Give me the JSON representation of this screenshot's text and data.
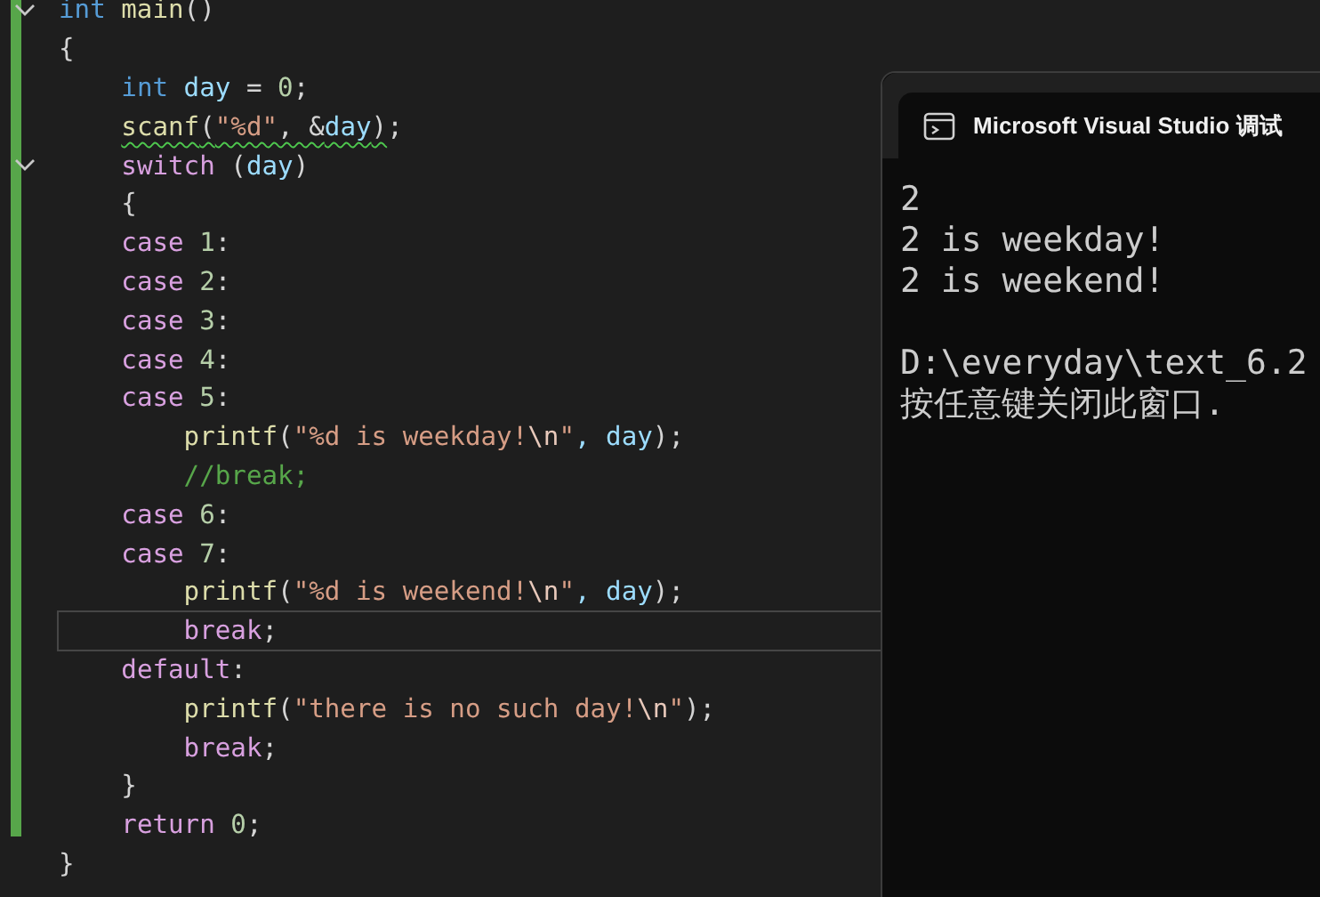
{
  "editor": {
    "lines": [
      {
        "foldable": true,
        "current": false,
        "warning": false,
        "tokens": [
          {
            "text": "int",
            "kind": "type"
          },
          {
            "text": " main",
            "kind": "func"
          },
          {
            "text": "()",
            "kind": "punct"
          }
        ]
      },
      {
        "foldable": false,
        "current": false,
        "warning": false,
        "tokens": [
          {
            "text": "{",
            "kind": "punct"
          }
        ]
      },
      {
        "foldable": false,
        "current": false,
        "warning": false,
        "tokens": [
          {
            "text": "    int",
            "kind": "type"
          },
          {
            "text": " day",
            "kind": "ident"
          },
          {
            "text": " = ",
            "kind": "punct"
          },
          {
            "text": "0",
            "kind": "number"
          },
          {
            "text": ";",
            "kind": "punct"
          }
        ]
      },
      {
        "foldable": false,
        "current": false,
        "warning": true,
        "tokens": [
          {
            "text": "    scanf",
            "kind": "func"
          },
          {
            "text": "(",
            "kind": "punct"
          },
          {
            "text": "\"%d\"",
            "kind": "string"
          },
          {
            "text": ", &",
            "kind": "punct"
          },
          {
            "text": "day",
            "kind": "ident"
          },
          {
            "text": ")",
            "kind": "punct"
          },
          {
            "text": ";",
            "kind": "punct"
          }
        ]
      },
      {
        "foldable": true,
        "current": false,
        "warning": false,
        "tokens": [
          {
            "text": "    switch",
            "kind": "control"
          },
          {
            "text": " (",
            "kind": "punct"
          },
          {
            "text": "day",
            "kind": "ident"
          },
          {
            "text": ")",
            "kind": "punct"
          }
        ]
      },
      {
        "foldable": false,
        "current": false,
        "warning": false,
        "tokens": [
          {
            "text": "    {",
            "kind": "punct"
          }
        ]
      },
      {
        "foldable": false,
        "current": false,
        "warning": false,
        "tokens": [
          {
            "text": "    case",
            "kind": "control"
          },
          {
            "text": " 1",
            "kind": "number"
          },
          {
            "text": ":",
            "kind": "punct"
          }
        ]
      },
      {
        "foldable": false,
        "current": false,
        "warning": false,
        "tokens": [
          {
            "text": "    case",
            "kind": "control"
          },
          {
            "text": " 2",
            "kind": "number"
          },
          {
            "text": ":",
            "kind": "punct"
          }
        ]
      },
      {
        "foldable": false,
        "current": false,
        "warning": false,
        "tokens": [
          {
            "text": "    case",
            "kind": "control"
          },
          {
            "text": " 3",
            "kind": "number"
          },
          {
            "text": ":",
            "kind": "punct"
          }
        ]
      },
      {
        "foldable": false,
        "current": false,
        "warning": false,
        "tokens": [
          {
            "text": "    case",
            "kind": "control"
          },
          {
            "text": " 4",
            "kind": "number"
          },
          {
            "text": ":",
            "kind": "punct"
          }
        ]
      },
      {
        "foldable": false,
        "current": false,
        "warning": false,
        "tokens": [
          {
            "text": "    case",
            "kind": "control"
          },
          {
            "text": " 5",
            "kind": "number"
          },
          {
            "text": ":",
            "kind": "punct"
          }
        ]
      },
      {
        "foldable": false,
        "current": false,
        "warning": false,
        "tokens": [
          {
            "text": "        printf",
            "kind": "func"
          },
          {
            "text": "(",
            "kind": "punct"
          },
          {
            "text": "\"%d is weekday!",
            "kind": "string"
          },
          {
            "text": "\\n",
            "kind": "escape"
          },
          {
            "text": "\"",
            "kind": "string"
          },
          {
            "text": ", day",
            "kind": "ident"
          },
          {
            "text": ");",
            "kind": "punct"
          }
        ]
      },
      {
        "foldable": false,
        "current": false,
        "warning": false,
        "tokens": [
          {
            "text": "        //break;",
            "kind": "comment"
          }
        ]
      },
      {
        "foldable": false,
        "current": false,
        "warning": false,
        "tokens": [
          {
            "text": "    case",
            "kind": "control"
          },
          {
            "text": " 6",
            "kind": "number"
          },
          {
            "text": ":",
            "kind": "punct"
          }
        ]
      },
      {
        "foldable": false,
        "current": false,
        "warning": false,
        "tokens": [
          {
            "text": "    case",
            "kind": "control"
          },
          {
            "text": " 7",
            "kind": "number"
          },
          {
            "text": ":",
            "kind": "punct"
          }
        ]
      },
      {
        "foldable": false,
        "current": false,
        "warning": false,
        "tokens": [
          {
            "text": "        printf",
            "kind": "func"
          },
          {
            "text": "(",
            "kind": "punct"
          },
          {
            "text": "\"%d is weekend!",
            "kind": "string"
          },
          {
            "text": "\\n",
            "kind": "escape"
          },
          {
            "text": "\"",
            "kind": "string"
          },
          {
            "text": ", day",
            "kind": "ident"
          },
          {
            "text": ");",
            "kind": "punct"
          }
        ]
      },
      {
        "foldable": false,
        "current": true,
        "warning": false,
        "tokens": [
          {
            "text": "        break",
            "kind": "control"
          },
          {
            "text": ";",
            "kind": "punct"
          }
        ]
      },
      {
        "foldable": false,
        "current": false,
        "warning": false,
        "tokens": [
          {
            "text": "    default",
            "kind": "control"
          },
          {
            "text": ":",
            "kind": "punct"
          }
        ]
      },
      {
        "foldable": false,
        "current": false,
        "warning": false,
        "tokens": [
          {
            "text": "        printf",
            "kind": "func"
          },
          {
            "text": "(",
            "kind": "punct"
          },
          {
            "text": "\"there is no such day!",
            "kind": "string"
          },
          {
            "text": "\\n",
            "kind": "escape"
          },
          {
            "text": "\"",
            "kind": "string"
          },
          {
            "text": ");",
            "kind": "punct"
          }
        ]
      },
      {
        "foldable": false,
        "current": false,
        "warning": false,
        "tokens": [
          {
            "text": "        break",
            "kind": "control"
          },
          {
            "text": ";",
            "kind": "punct"
          }
        ]
      },
      {
        "foldable": false,
        "current": false,
        "warning": false,
        "tokens": [
          {
            "text": "    }",
            "kind": "punct"
          }
        ]
      },
      {
        "foldable": false,
        "current": false,
        "warning": false,
        "tokens": [
          {
            "text": "    return",
            "kind": "control"
          },
          {
            "text": " 0",
            "kind": "number"
          },
          {
            "text": ";",
            "kind": "punct"
          }
        ]
      },
      {
        "foldable": false,
        "current": false,
        "warning": false,
        "tokens": [
          {
            "text": "}",
            "kind": "punct"
          }
        ]
      }
    ]
  },
  "console": {
    "title": "Microsoft Visual Studio 调试",
    "lines": [
      "2",
      "2 is weekday!",
      "2 is weekend!",
      "D:\\everyday\\text_6.2",
      "按任意键关闭此窗口."
    ]
  }
}
